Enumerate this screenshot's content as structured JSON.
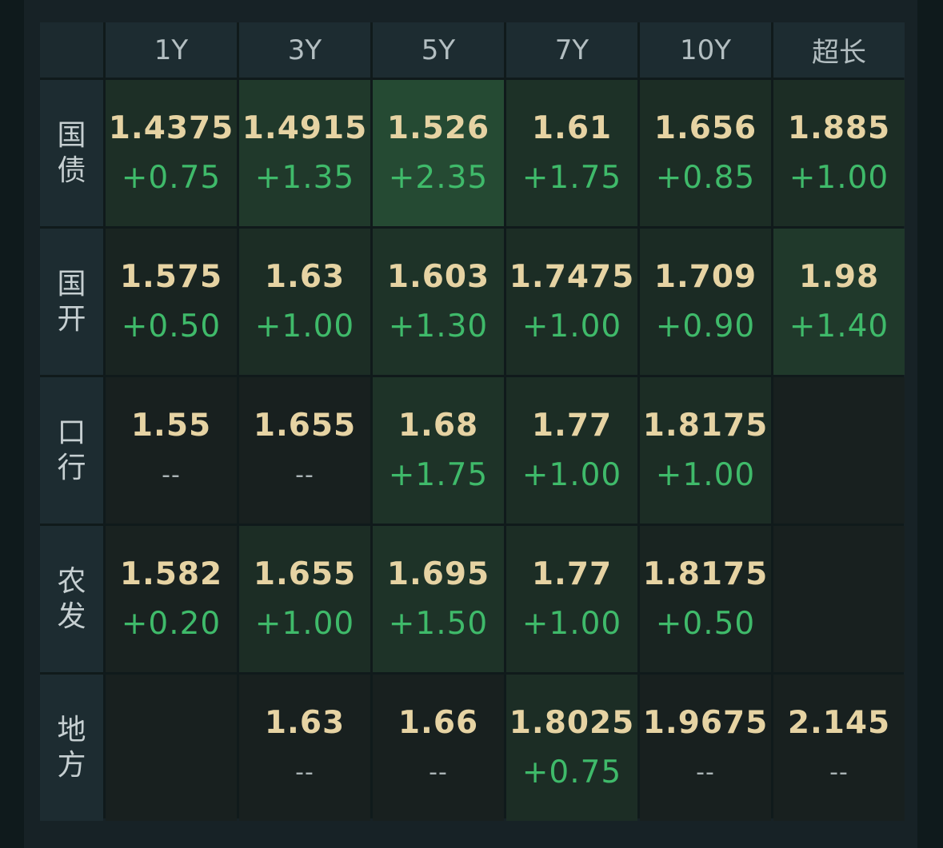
{
  "colors": {
    "yield": "#e6d3a3",
    "change_positive": "#3fba6a",
    "change_none": "#aab4b6",
    "header_bg": "#1d2c31",
    "cell_base": "#18201f",
    "heat_low": "#1b2823",
    "heat_mid": "#1e3127",
    "heat_high": "#254a33"
  },
  "columns": [
    "1Y",
    "3Y",
    "5Y",
    "7Y",
    "10Y",
    "超长"
  ],
  "rows": [
    {
      "label": "国债",
      "cells": [
        {
          "yield": "1.4375",
          "change": "+0.75",
          "heat": 0.35
        },
        {
          "yield": "1.4915",
          "change": "+1.35",
          "heat": 0.6
        },
        {
          "yield": "1.526",
          "change": "+2.35",
          "heat": 1.0
        },
        {
          "yield": "1.61",
          "change": "+1.75",
          "heat": 0.4
        },
        {
          "yield": "1.656",
          "change": "+0.85",
          "heat": 0.3
        },
        {
          "yield": "1.885",
          "change": "+1.00",
          "heat": 0.3
        }
      ]
    },
    {
      "label": "国开",
      "cells": [
        {
          "yield": "1.575",
          "change": "+0.50",
          "heat": 0.1
        },
        {
          "yield": "1.63",
          "change": "+1.00",
          "heat": 0.3
        },
        {
          "yield": "1.603",
          "change": "+1.30",
          "heat": 0.45
        },
        {
          "yield": "1.7475",
          "change": "+1.00",
          "heat": 0.3
        },
        {
          "yield": "1.709",
          "change": "+0.90",
          "heat": 0.25
        },
        {
          "yield": "1.98",
          "change": "+1.40",
          "heat": 0.6
        }
      ]
    },
    {
      "label": "口行",
      "cells": [
        {
          "yield": "1.55",
          "change": "--",
          "heat": 0.0
        },
        {
          "yield": "1.655",
          "change": "--",
          "heat": 0.0
        },
        {
          "yield": "1.68",
          "change": "+1.75",
          "heat": 0.45
        },
        {
          "yield": "1.77",
          "change": "+1.00",
          "heat": 0.3
        },
        {
          "yield": "1.8175",
          "change": "+1.00",
          "heat": 0.3
        },
        {
          "yield": "",
          "change": "",
          "heat": 0.0
        }
      ]
    },
    {
      "label": "农发",
      "cells": [
        {
          "yield": "1.582",
          "change": "+0.20",
          "heat": 0.05
        },
        {
          "yield": "1.655",
          "change": "+1.00",
          "heat": 0.3
        },
        {
          "yield": "1.695",
          "change": "+1.50",
          "heat": 0.45
        },
        {
          "yield": "1.77",
          "change": "+1.00",
          "heat": 0.3
        },
        {
          "yield": "1.8175",
          "change": "+0.50",
          "heat": 0.1
        },
        {
          "yield": "",
          "change": "",
          "heat": 0.0
        }
      ]
    },
    {
      "label": "地方",
      "cells": [
        {
          "yield": "",
          "change": "",
          "heat": 0.0
        },
        {
          "yield": "1.63",
          "change": "--",
          "heat": 0.0
        },
        {
          "yield": "1.66",
          "change": "--",
          "heat": 0.0
        },
        {
          "yield": "1.8025",
          "change": "+0.75",
          "heat": 0.3
        },
        {
          "yield": "1.9675",
          "change": "--",
          "heat": 0.0
        },
        {
          "yield": "2.145",
          "change": "--",
          "heat": 0.0
        }
      ]
    }
  ]
}
